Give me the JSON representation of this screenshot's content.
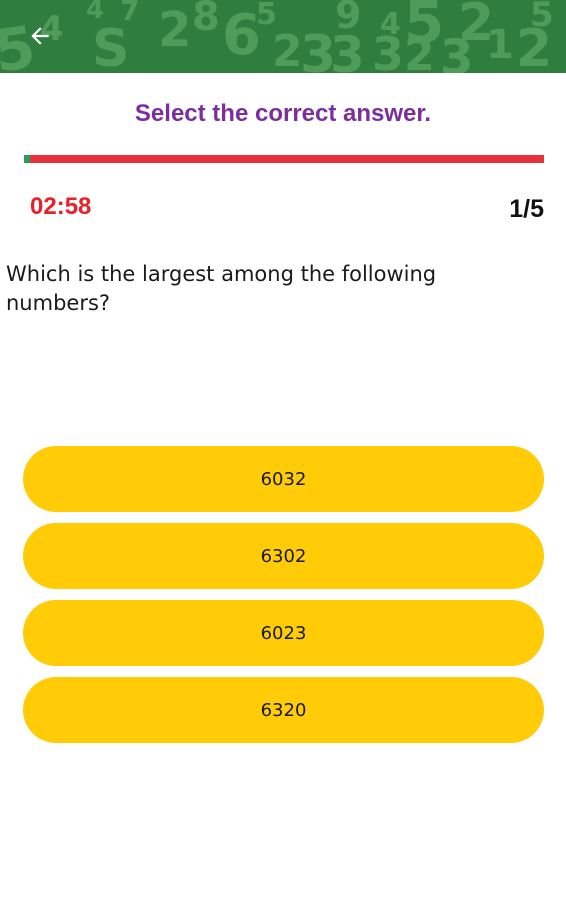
{
  "header": {
    "back_icon": "arrow-left-icon",
    "background_digits": [
      "5",
      "4",
      "S",
      "2",
      "8",
      "6",
      "2",
      "3",
      "3",
      "3",
      "2",
      "9",
      "4",
      "5",
      "3",
      "2",
      "3",
      "1",
      "2",
      "4",
      "5",
      "7"
    ]
  },
  "quiz": {
    "instruction": "Select the correct answer.",
    "progress_fraction": 0.012,
    "timer": "02:58",
    "counter": "1/5",
    "question": "Which is the largest among the following numbers?",
    "options": [
      "6032",
      "6302",
      "6023",
      "6320"
    ]
  },
  "colors": {
    "header_bg": "#2f7d3f",
    "instruction": "#7b2ea0",
    "progress_remaining": "#e8313a",
    "progress_done": "#2a9d5a",
    "timer": "#e8202a",
    "option_bg": "#ffcc07"
  }
}
